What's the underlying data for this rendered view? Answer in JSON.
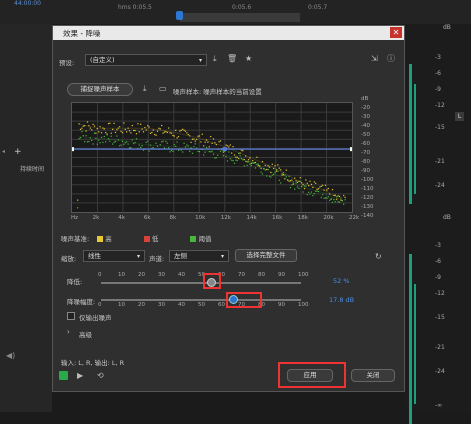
{
  "background": {
    "timecode_top": "44:00:00",
    "ruler": [
      "hms 0:05.5",
      "0:05.6",
      "0:05.7"
    ],
    "left_label": "持续时间",
    "right_db_top": [
      "dB",
      "-3",
      "-6",
      "-9",
      "-12",
      "-15",
      "-21",
      "-24"
    ],
    "right_db_bottom": [
      "dB",
      "-3",
      "-6",
      "-9",
      "-12",
      "-15",
      "-21",
      "-24",
      "-∞"
    ],
    "channel_L": "L"
  },
  "dialog": {
    "title": "效果 - 降噪",
    "close": "✕",
    "preset_label": "预设:",
    "preset_value": "(自定义)",
    "capture_button": "捕捉噪声样本",
    "noise_hint": "噪声样本: 噪声样本的当前设置",
    "y_ticks": [
      "dB",
      "-20",
      "-30",
      "-40",
      "-50",
      "-60",
      "-70",
      "-80",
      "-90",
      "-100",
      "-110",
      "-120",
      "-130",
      "-140"
    ],
    "x_ticks": [
      "Hz",
      "2k",
      "4k",
      "6k",
      "8k",
      "10k",
      "12k",
      "14k",
      "16k",
      "18k",
      "20k",
      "22k"
    ],
    "legend": {
      "label": "噪声基准:",
      "high": "高",
      "low": "低",
      "threshold": "阈值",
      "colors": {
        "high": "#e8c933",
        "low": "#d9423a",
        "threshold": "#48b83a"
      }
    },
    "scale_label": "缩放:",
    "scale_value": "线性",
    "channel_label": "声道:",
    "channel_value": "左侧",
    "select_all_button": "选择完整文件",
    "reduction_label": "降低:",
    "reduction_value": "52 %",
    "reduction_ticks": [
      "0",
      "10",
      "20",
      "30",
      "40",
      "50",
      "60",
      "70",
      "80",
      "90",
      "100"
    ],
    "reduce_by_label": "降噪幅度:",
    "reduce_by_value": "17.8 dB",
    "reduce_by_ticks": [
      "0",
      "10",
      "20",
      "30",
      "40",
      "50",
      "60",
      "70",
      "80",
      "90",
      "100"
    ],
    "output_noise_only": "仅输出噪声",
    "advanced": "高级",
    "io_text": "输入: L, R, 输出: L, R",
    "apply": "应用",
    "close_button": "关闭"
  },
  "chart_data": {
    "type": "scatter",
    "title": "",
    "xlabel": "Hz",
    "ylabel": "dB",
    "xlim": [
      0,
      22000
    ],
    "ylim": [
      -140,
      -10
    ],
    "series": [
      {
        "name": "高",
        "color": "#e8c933",
        "x": [
          500,
          2000,
          4000,
          6000,
          8000,
          10000,
          12000,
          14000,
          16000,
          18000,
          20000,
          21000
        ],
        "y": [
          -35,
          -40,
          -40,
          -40,
          -45,
          -52,
          -62,
          -75,
          -88,
          -105,
          -115,
          -125
        ]
      },
      {
        "name": "阈值",
        "color": "#48b83a",
        "x": [
          500,
          2000,
          4000,
          6000,
          8000,
          10000,
          12000,
          14000,
          16000,
          18000,
          20000,
          21000
        ],
        "y": [
          -50,
          -52,
          -55,
          -60,
          -62,
          -65,
          -72,
          -80,
          -95,
          -110,
          -118,
          -128
        ]
      }
    ],
    "curve": {
      "x": [
        0,
        12000,
        22000
      ],
      "y": [
        -65,
        -65,
        -65
      ]
    }
  }
}
